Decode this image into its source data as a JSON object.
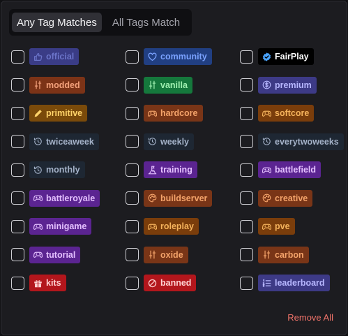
{
  "toggle": {
    "any_label": "Any Tag Matches",
    "all_label": "All Tags Match"
  },
  "tags": [
    {
      "label": "official",
      "icon": "thumbs-up-icon",
      "color": "#6b74c9",
      "bg": "#3a3c86"
    },
    {
      "label": "community",
      "icon": "heart-icon",
      "color": "#7aa2ff",
      "bg": "#213f82"
    },
    {
      "label": "FairPlay",
      "icon": "verified-badge-icon",
      "color": "#ffffff",
      "bg": "#000000",
      "iconColor": "#4aa4ff"
    },
    {
      "label": "modded",
      "icon": "sliders-icon",
      "color": "#f3a07a",
      "bg": "#7c3317"
    },
    {
      "label": "vanilla",
      "icon": "sliders-icon",
      "color": "#9ff0b0",
      "bg": "#15783c"
    },
    {
      "label": "premium",
      "icon": "dollar-coin-icon",
      "color": "#b7b7ff",
      "bg": "#3d3a86"
    },
    {
      "label": "primitive",
      "icon": "pencil-icon",
      "color": "#ffd36a",
      "bg": "#7a4a0a"
    },
    {
      "label": "hardcore",
      "icon": "gamepad-icon",
      "color": "#f4a36a",
      "bg": "#793517"
    },
    {
      "label": "softcore",
      "icon": "gamepad-icon",
      "color": "#f5b35c",
      "bg": "#7a3d0b"
    },
    {
      "label": "twiceaweek",
      "icon": "history-icon",
      "color": "#a3b1c7",
      "bg": "#1e2733"
    },
    {
      "label": "weekly",
      "icon": "history-icon",
      "color": "#a3b1c7",
      "bg": "#1e2733"
    },
    {
      "label": "everytwoweeks",
      "icon": "history-icon",
      "color": "#a3b1c7",
      "bg": "#1e2733"
    },
    {
      "label": "monthly",
      "icon": "history-icon",
      "color": "#a3b1c7",
      "bg": "#1e2733"
    },
    {
      "label": "training",
      "icon": "mountain-flag-icon",
      "color": "#e4c0ff",
      "bg": "#5b2491"
    },
    {
      "label": "battlefield",
      "icon": "gamepad-icon",
      "color": "#e4c0ff",
      "bg": "#5b2491"
    },
    {
      "label": "battleroyale",
      "icon": "gamepad-icon",
      "color": "#e4c0ff",
      "bg": "#5b2491"
    },
    {
      "label": "buildserver",
      "icon": "palette-icon",
      "color": "#f4a36a",
      "bg": "#793517"
    },
    {
      "label": "creative",
      "icon": "palette-icon",
      "color": "#f4a36a",
      "bg": "#793517"
    },
    {
      "label": "minigame",
      "icon": "gamepad-icon",
      "color": "#e4c0ff",
      "bg": "#5b2491"
    },
    {
      "label": "roleplay",
      "icon": "gamepad-icon",
      "color": "#f5b35c",
      "bg": "#7a3d0b"
    },
    {
      "label": "pve",
      "icon": "gamepad-icon",
      "color": "#f5b35c",
      "bg": "#7a3d0b"
    },
    {
      "label": "tutorial",
      "icon": "gamepad-icon",
      "color": "#e4c0ff",
      "bg": "#5b2491"
    },
    {
      "label": "oxide",
      "icon": "sliders-icon",
      "color": "#f4a36a",
      "bg": "#793517"
    },
    {
      "label": "carbon",
      "icon": "sliders-icon",
      "color": "#f4a36a",
      "bg": "#793517"
    },
    {
      "label": "kits",
      "icon": "gift-icon",
      "color": "#ffd2d2",
      "bg": "#b3161c"
    },
    {
      "label": "banned",
      "icon": "ban-icon",
      "color": "#ffd2d2",
      "bg": "#b3161c"
    },
    {
      "label": "leaderboard",
      "icon": "ordered-list-icon",
      "color": "#b7b7ff",
      "bg": "#3d3a86"
    }
  ],
  "remove_all_label": "Remove All"
}
